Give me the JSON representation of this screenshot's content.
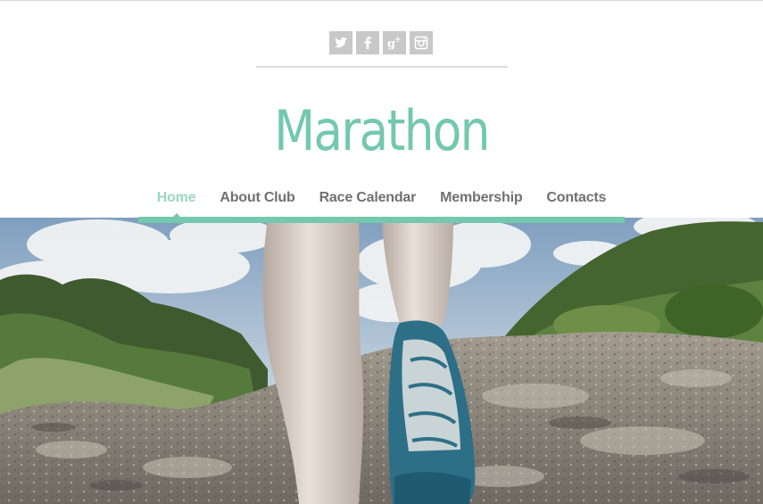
{
  "social": {
    "items": [
      {
        "icon": "twitter-icon",
        "glyph": "twitter"
      },
      {
        "icon": "facebook-icon",
        "glyph": "f"
      },
      {
        "icon": "google-plus-icon",
        "glyph": "g+"
      },
      {
        "icon": "instagram-icon",
        "glyph": "instagram"
      }
    ]
  },
  "brand": {
    "title": "Marathon",
    "accent_color": "#73c8ad"
  },
  "nav": {
    "items": [
      {
        "label": "Home",
        "active": true
      },
      {
        "label": "About Club",
        "active": false
      },
      {
        "label": "Race Calendar",
        "active": false
      },
      {
        "label": "Membership",
        "active": false
      },
      {
        "label": "Contacts",
        "active": false
      }
    ]
  },
  "hero": {
    "image": "runner-legs-on-rocky-trail"
  }
}
